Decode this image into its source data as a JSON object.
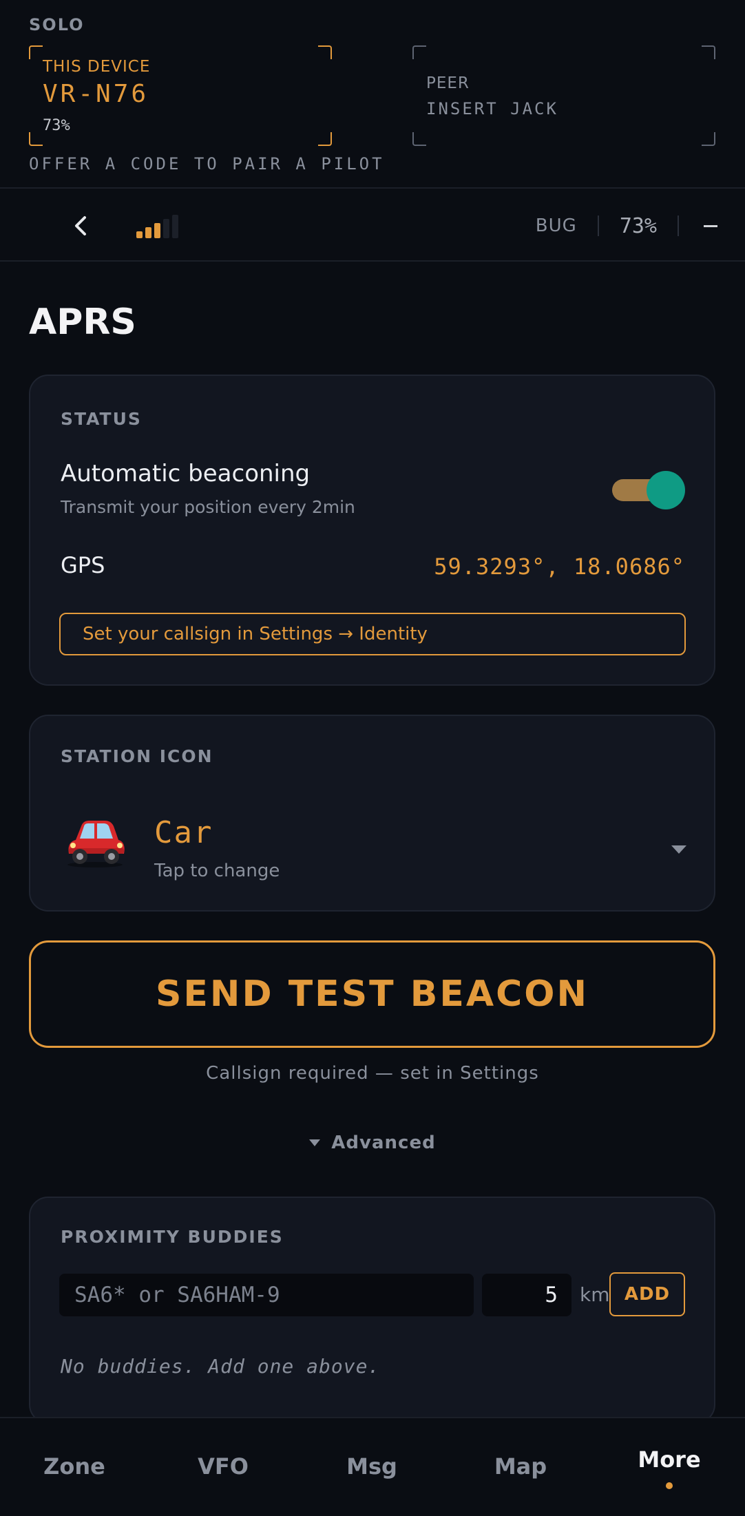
{
  "pairing": {
    "mode": "SOLO",
    "device": {
      "label": "THIS DEVICE",
      "id": "VR-N76",
      "battery": "73%"
    },
    "peer": {
      "label": "PEER",
      "status": "INSERT JACK"
    },
    "hint": "OFFER A CODE TO PAIR A PILOT"
  },
  "toolbar": {
    "back_icon": "chevron-left-icon",
    "signal_bars_lit": 3,
    "signal_bars_total": 5,
    "bug": "BUG",
    "battery": "73%",
    "minus_icon": "minus-icon"
  },
  "page": {
    "title": "APRS"
  },
  "status": {
    "section": "STATUS",
    "beacon_title": "Automatic beaconing",
    "beacon_sub": "Transmit your position every 2min",
    "beacon_enabled": true,
    "gps_label": "GPS",
    "gps_value": "59.3293°, 18.0686°",
    "warning": "Set your callsign in Settings → Identity"
  },
  "station_icon": {
    "section": "STATION ICON",
    "icon": "car-icon",
    "name": "Car",
    "sub": "Tap to change"
  },
  "send": {
    "label": "SEND TEST BEACON",
    "note": "Callsign required — set in Settings"
  },
  "advanced": {
    "label": "Advanced"
  },
  "buddies": {
    "section": "PROXIMITY BUDDIES",
    "placeholder": "SA6* or SA6HAM-9",
    "radius": "5",
    "unit": "km",
    "add_label": "ADD",
    "empty": "No buddies. Add one above."
  },
  "nav": {
    "items": [
      {
        "label": "Zone"
      },
      {
        "label": "VFO"
      },
      {
        "label": "Msg"
      },
      {
        "label": "Map"
      },
      {
        "label": "More"
      }
    ],
    "active_index": 4
  },
  "colors": {
    "accent": "#e39a3c",
    "toggle_knob": "#0f9b84",
    "background": "#0a0d13",
    "card": "#121620"
  }
}
